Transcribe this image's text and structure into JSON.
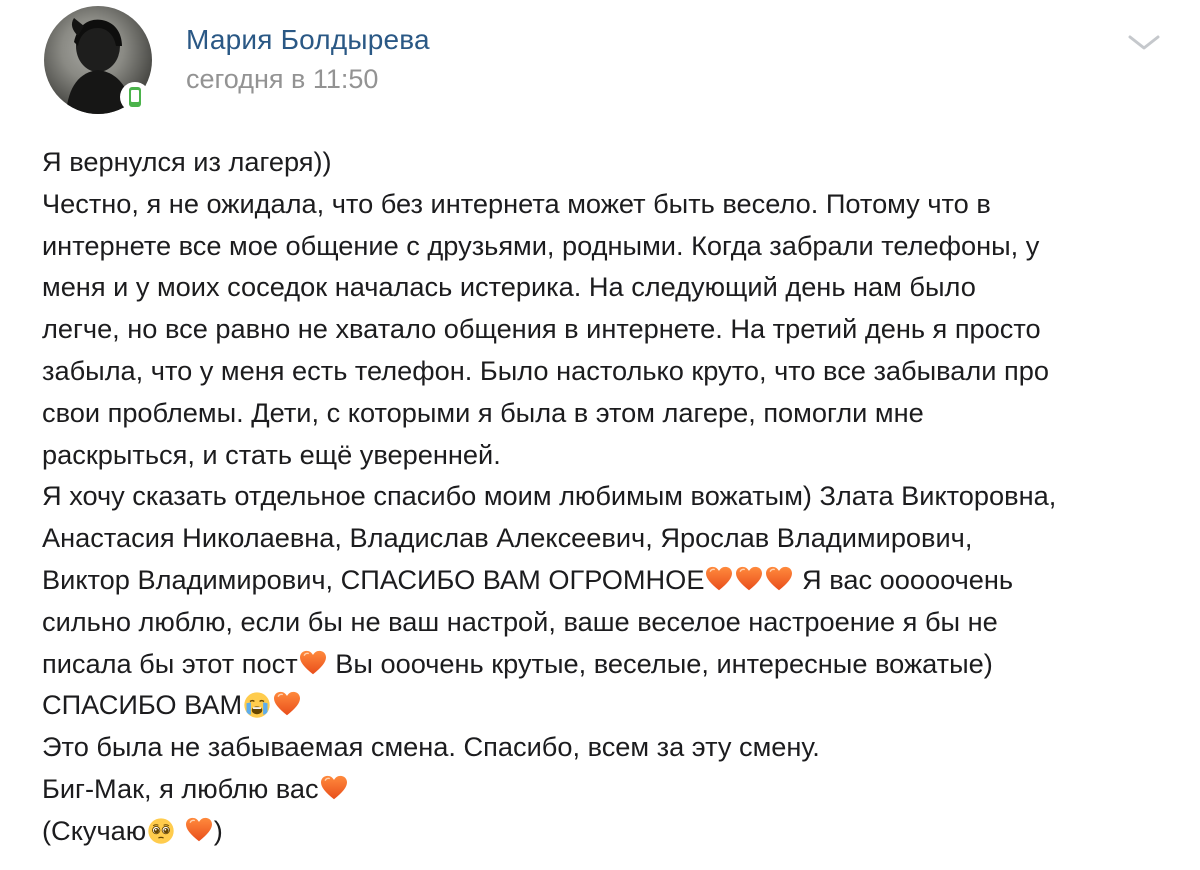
{
  "post": {
    "author": "Мария Болдырева",
    "date": "сегодня в 11:50",
    "lines": {
      "l1": "Я вернулся из лагеря))",
      "l2": "Честно, я не ожидала, что без интернета может быть весело. Потому что в",
      "l3": "интернете все мое общение с друзьями, родными. Когда забрали телефоны, у",
      "l4": "меня и у моих соседок началась истерика. На следующий день нам было",
      "l5": "легче, но все равно не хватало общения в интернете. На третий день я просто",
      "l6": "забыла, что у меня есть телефон. Было настолько круто, что все забывали про",
      "l7": "свои проблемы. Дети, с которыми я была в этом лагере, помогли мне",
      "l8": "раскрыться, и стать ещё уверенней.",
      "l9": "Я хочу сказать отдельное спасибо моим любимым вожатым) Злата Викторовна,",
      "l10": "Анастасия Николаевна, Владислав Алексеевич, Ярослав Владимирович,",
      "l11a": "Виктор Владимирович, СПАСИБО ВАМ ОГРОМНОЕ",
      "l11b": " Я вас ооооочень",
      "l12": "сильно люблю, если бы не ваш настрой, ваше веселое настроение я бы не",
      "l13a": "писала бы этот пост",
      "l13b": " Вы ооочень крутые, веселые, интересные вожатые)",
      "l14a": "СПАСИБО ВАМ",
      "l15": "Это была не забываемая смена. Спасибо, всем за эту смену.",
      "l16a": "Биг-Мак, я люблю вас",
      "l17a": "(Скучаю",
      "l17b": " ",
      "l17c": ")"
    }
  },
  "icons": {
    "heart": "orange-heart-emoji",
    "crying": "loudly-crying-face-emoji",
    "pleading": "pleading-face-emoji",
    "menu": "chevron-down-icon",
    "online": "mobile-online-icon"
  },
  "colors": {
    "author": "#2a5885",
    "date": "#939393",
    "text": "#1c1c1e",
    "heart": "#f0662c",
    "online": "#4bb34b"
  }
}
